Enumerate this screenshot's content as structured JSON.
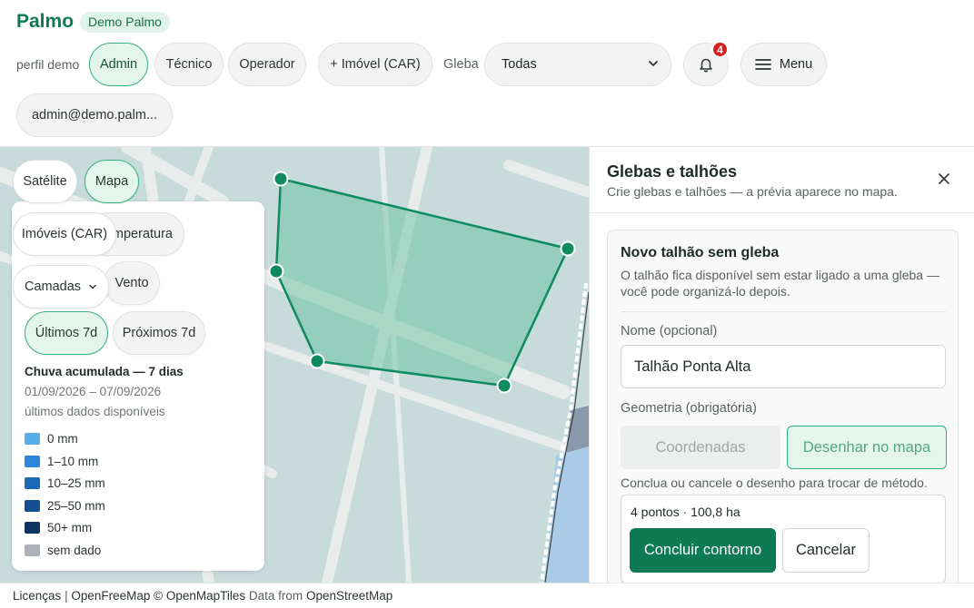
{
  "app": {
    "brand": "Palmo",
    "badge": "Demo Palmo"
  },
  "header": {
    "profile_label": "perfil demo",
    "profiles": [
      "Admin",
      "Técnico",
      "Operador"
    ],
    "active_profile": "Admin",
    "add_property": "+ Imóvel (CAR)",
    "gleba_label": "Gleba",
    "gleba_value": "Todas",
    "notifications_count": "4",
    "menu_label": "Menu",
    "user_email": "admin@demo.palm..."
  },
  "map": {
    "layer_satellite": "Satélite",
    "layer_map": "Mapa",
    "properties_button": "Imóveis (CAR)",
    "temperature_button": "mperatura",
    "layers_button": "Camadas",
    "wind_button": "Vento",
    "last_7d": "Últimos 7d",
    "next_7d": "Próximos 7d",
    "polygon_color": "#0e8a5f"
  },
  "legend": {
    "title": "Chuva acumulada — 7 dias",
    "dates": "01/09/2026 – 07/09/2026",
    "subtitle": "últimos dados disponíveis",
    "items": [
      {
        "label": "0 mm",
        "color": "#5aaee8"
      },
      {
        "label": "1–10 mm",
        "color": "#2b86dc"
      },
      {
        "label": "10–25 mm",
        "color": "#1d67b8"
      },
      {
        "label": "25–50 mm",
        "color": "#154f8f"
      },
      {
        "label": "50+ mm",
        "color": "#0d3460"
      },
      {
        "label": "sem dado",
        "color": "#aeb2b8"
      }
    ]
  },
  "attribution": {
    "licenses": "Licenças",
    "sep": "|",
    "sources": "OpenFreeMap © OpenMapTiles",
    "data_from": "Data from",
    "osm": "OpenStreetMap"
  },
  "panel": {
    "title": "Glebas e talhões",
    "subtitle": "Crie glebas e talhões — a prévia aparece no mapa.",
    "card_title": "Novo talhão sem gleba",
    "card_desc": "O talhão fica disponível sem estar ligado a uma gleba — você pode organizá-lo depois.",
    "name_label": "Nome (opcional)",
    "name_value": "Talhão Ponta Alta",
    "geometry_label": "Geometria (obrigatória)",
    "method_coords": "Coordenadas",
    "method_draw": "Desenhar no mapa",
    "hint": "Conclua ou cancele o desenho para trocar de método.",
    "draw_stats": "4 pontos · 100,8 ha",
    "finish_button": "Concluir contorno",
    "cancel_button": "Cancelar"
  }
}
